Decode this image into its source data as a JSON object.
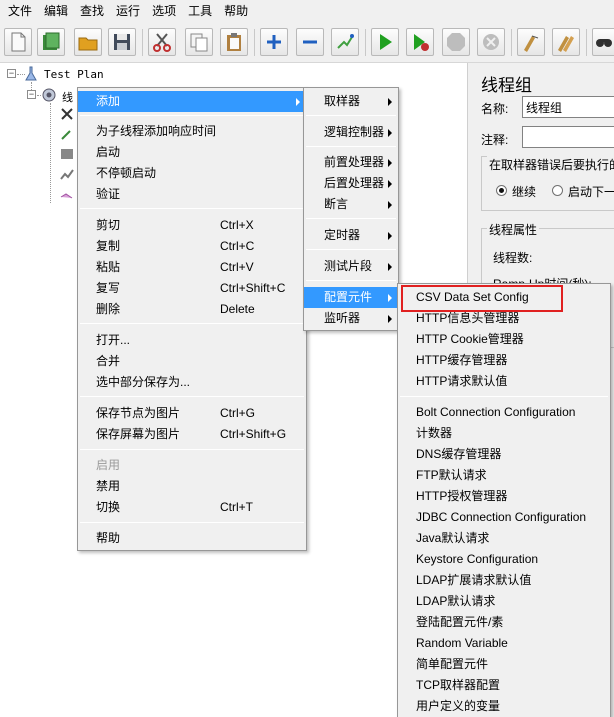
{
  "menubar": [
    "文件",
    "编辑",
    "查找",
    "运行",
    "选项",
    "工具",
    "帮助"
  ],
  "toolbar": [
    {
      "icon": "new-icon",
      "color": "#f5f5f5"
    },
    {
      "icon": "templates-icon",
      "color": "#3a8a3a"
    },
    {
      "icon": "open-icon",
      "color": "#e0a020"
    },
    {
      "icon": "save-icon",
      "color": "#404a5a"
    },
    {
      "icon": "cut-icon",
      "color": "#c03030"
    },
    {
      "icon": "copy-icon",
      "color": "#9aa0a8"
    },
    {
      "icon": "paste-icon",
      "color": "#b08040"
    },
    {
      "icon": "expand-icon",
      "color": "#2060c0"
    },
    {
      "icon": "collapse-icon",
      "color": "#2060c0"
    },
    {
      "icon": "toggle-icon",
      "color": "#40a040"
    },
    {
      "icon": "start-icon",
      "color": "#20a020"
    },
    {
      "icon": "start-no-pause-icon",
      "color": "#20a020"
    },
    {
      "icon": "stop-icon",
      "color": "#b0b0b0"
    },
    {
      "icon": "shutdown-icon",
      "color": "#b0b0b0"
    },
    {
      "icon": "clear-icon",
      "color": "#c09040"
    },
    {
      "icon": "clear-all-icon",
      "color": "#c09040"
    },
    {
      "icon": "search-icon",
      "color": "#303030"
    }
  ],
  "tree": {
    "root_label": "Test Plan",
    "child_label": "线"
  },
  "panel": {
    "title": "线程组",
    "name_label": "名称:",
    "name_value": "线程组",
    "comment_label": "注释:",
    "comment_value": "",
    "error_group_title": "在取样器错误后要执行的",
    "radio_continue": "继续",
    "radio_start_next": "启动下一",
    "props_title": "线程属性",
    "threads_label": "线程数:",
    "rampup_label": "Ramp-Up时间(秒):"
  },
  "context_menu": {
    "add": "添加",
    "add_think_time": "为子线程添加响应时间",
    "start": "启动",
    "start_no_pause": "不停顿启动",
    "validate": "验证",
    "cut": "剪切",
    "cut_sc": "Ctrl+X",
    "copy": "复制",
    "copy_sc": "Ctrl+C",
    "paste": "粘贴",
    "paste_sc": "Ctrl+V",
    "duplicate": "复写",
    "duplicate_sc": "Ctrl+Shift+C",
    "delete": "删除",
    "delete_sc": "Delete",
    "open": "打开...",
    "merge": "合并",
    "save_selection": "选中部分保存为...",
    "save_node_image": "保存节点为图片",
    "save_node_image_sc": "Ctrl+G",
    "save_screen_image": "保存屏幕为图片",
    "save_screen_image_sc": "Ctrl+Shift+G",
    "enable": "启用",
    "disable": "禁用",
    "toggle": "切换",
    "toggle_sc": "Ctrl+T",
    "help": "帮助"
  },
  "add_submenu": {
    "sampler": "取样器",
    "logic_controller": "逻辑控制器",
    "pre_processor": "前置处理器",
    "post_processor": "后置处理器",
    "assertion": "断言",
    "timer": "定时器",
    "test_fragment": "测试片段",
    "config_element": "配置元件",
    "listener": "监听器"
  },
  "config_submenu": [
    "CSV Data Set Config",
    "HTTP信息头管理器",
    "HTTP Cookie管理器",
    "HTTP缓存管理器",
    "HTTP请求默认值",
    "Bolt Connection Configuration",
    "计数器",
    "DNS缓存管理器",
    "FTP默认请求",
    "HTTP授权管理器",
    "JDBC Connection Configuration",
    "Java默认请求",
    "Keystore Configuration",
    "LDAP扩展请求默认值",
    "LDAP默认请求",
    "登陆配置元件/素",
    "Random Variable",
    "简单配置元件",
    "TCP取样器配置",
    "用户定义的变量"
  ],
  "colors": {
    "highlight": "#3399ff",
    "callout": "#e02020",
    "menu_bg": "#f0f0f0"
  }
}
